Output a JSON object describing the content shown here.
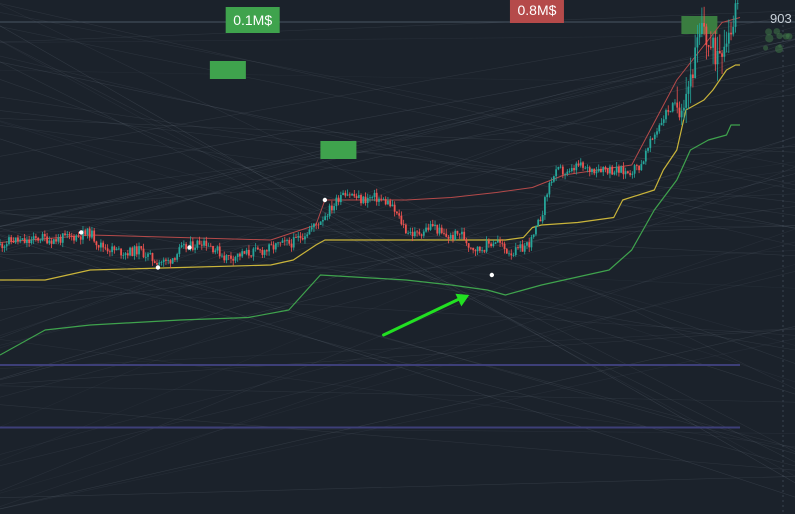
{
  "chart_data": {
    "type": "candlestick",
    "title": "",
    "xlabel": "",
    "ylabel": "",
    "ylim": [
      0,
      100
    ],
    "grid": false,
    "legend": "none",
    "y_axis_labels": [
      {
        "value": 96.2,
        "text": "903"
      }
    ],
    "volume_labels": [
      {
        "text": "0.1M$",
        "x": 56,
        "y": 96,
        "color": "#3fa34d"
      },
      {
        "text": "0.8M$",
        "x": 119,
        "y": 98,
        "color": "#b54a4a"
      }
    ],
    "volume_boxes": [
      {
        "x": 50.5,
        "y": 86,
        "color": "#3fa34d"
      },
      {
        "x": 75,
        "y": 70,
        "color": "#3fa34d"
      },
      {
        "x": 155,
        "y": 95,
        "color": "#3a7d40"
      }
    ],
    "price": [
      [
        0,
        51
      ],
      [
        3,
        52
      ],
      [
        6,
        51.5
      ],
      [
        9,
        52.5
      ],
      [
        12,
        52
      ],
      [
        15,
        52.5
      ],
      [
        18,
        53
      ],
      [
        20,
        53.5
      ],
      [
        22,
        51
      ],
      [
        25,
        50
      ],
      [
        28,
        49.5
      ],
      [
        31,
        50
      ],
      [
        34,
        48
      ],
      [
        37,
        47.5
      ],
      [
        40,
        50
      ],
      [
        43,
        51
      ],
      [
        45,
        52
      ],
      [
        48,
        50
      ],
      [
        50,
        48.5
      ],
      [
        53,
        49
      ],
      [
        56,
        49.5
      ],
      [
        59,
        50
      ],
      [
        62,
        51
      ],
      [
        65,
        51.5
      ],
      [
        67,
        53
      ],
      [
        70,
        55
      ],
      [
        72,
        57
      ],
      [
        74,
        59
      ],
      [
        76,
        62
      ],
      [
        78,
        61
      ],
      [
        80,
        60
      ],
      [
        83,
        60.5
      ],
      [
        86,
        59.5
      ],
      [
        88,
        57
      ],
      [
        90,
        54
      ],
      [
        92,
        53
      ],
      [
        94,
        54
      ],
      [
        96,
        55
      ],
      [
        98,
        53
      ],
      [
        100,
        52.5
      ],
      [
        102,
        53.5
      ],
      [
        104,
        51
      ],
      [
        106,
        50
      ],
      [
        108,
        51
      ],
      [
        110,
        52
      ],
      [
        112,
        50
      ],
      [
        114,
        49.5
      ],
      [
        116,
        50.5
      ],
      [
        118,
        52
      ],
      [
        120,
        57
      ],
      [
        122,
        64
      ],
      [
        124,
        66
      ],
      [
        126,
        65
      ],
      [
        128,
        67
      ],
      [
        130,
        66
      ],
      [
        133,
        66.5
      ],
      [
        136,
        66
      ],
      [
        139,
        65.5
      ],
      [
        142,
        67
      ],
      [
        144,
        71
      ],
      [
        146,
        75
      ],
      [
        148,
        78
      ],
      [
        150,
        79
      ],
      [
        152,
        82
      ],
      [
        154,
        88
      ],
      [
        156,
        95
      ],
      [
        157,
        91
      ],
      [
        158,
        89
      ],
      [
        160,
        92
      ],
      [
        162,
        95
      ],
      [
        163,
        99.5
      ],
      [
        164,
        96
      ]
    ],
    "pivots": [
      [
        18,
        53.5
      ],
      [
        35,
        46.5
      ],
      [
        42,
        50.5
      ],
      [
        72,
        60
      ],
      [
        109,
        45
      ]
    ],
    "upper_band": [
      [
        0,
        51.5
      ],
      [
        20,
        53
      ],
      [
        40,
        52.5
      ],
      [
        60,
        52
      ],
      [
        70,
        55
      ],
      [
        72,
        60
      ],
      [
        90,
        60
      ],
      [
        100,
        60.5
      ],
      [
        110,
        61.5
      ],
      [
        118,
        62.5
      ],
      [
        125,
        65
      ],
      [
        140,
        67
      ],
      [
        150,
        84
      ],
      [
        160,
        95.5
      ],
      [
        164,
        96.5
      ]
    ],
    "yellow_band": [
      [
        0,
        44
      ],
      [
        10,
        44
      ],
      [
        20,
        46
      ],
      [
        40,
        46.5
      ],
      [
        60,
        47
      ],
      [
        65,
        48
      ],
      [
        70,
        51
      ],
      [
        72,
        52
      ],
      [
        100,
        52
      ],
      [
        112,
        52
      ],
      [
        116,
        52.5
      ],
      [
        118,
        54.5
      ],
      [
        120,
        55
      ],
      [
        128,
        55.5
      ],
      [
        136,
        56.5
      ],
      [
        138,
        60
      ],
      [
        145,
        62
      ],
      [
        147,
        66
      ],
      [
        150,
        70
      ],
      [
        152,
        78
      ],
      [
        156,
        80
      ],
      [
        158,
        82
      ],
      [
        161,
        86
      ],
      [
        163,
        87
      ],
      [
        164,
        87
      ]
    ],
    "green_band": [
      [
        0,
        29
      ],
      [
        10,
        34
      ],
      [
        20,
        35
      ],
      [
        30,
        35.5
      ],
      [
        40,
        36
      ],
      [
        55,
        36.5
      ],
      [
        64,
        38
      ],
      [
        68,
        42
      ],
      [
        71,
        45
      ],
      [
        90,
        44
      ],
      [
        100,
        43
      ],
      [
        108,
        42
      ],
      [
        112,
        41
      ],
      [
        116,
        42
      ],
      [
        120,
        43
      ],
      [
        125,
        44
      ],
      [
        135,
        46
      ],
      [
        140,
        50
      ],
      [
        145,
        58
      ],
      [
        150,
        64
      ],
      [
        153,
        70
      ],
      [
        157,
        72
      ],
      [
        161,
        73
      ],
      [
        162,
        75
      ],
      [
        164,
        75
      ]
    ],
    "annotation_arrow": {
      "from": [
        85,
        33
      ],
      "to": [
        104,
        41
      ],
      "color": "#22e022"
    },
    "horizontal_lines": [
      {
        "y": 27,
        "color": "#3d3f78"
      },
      {
        "y": 14.5,
        "color": "#3d3f78"
      }
    ],
    "colors": {
      "background": "#1b222b",
      "up": "#26a69a",
      "down": "#ef5350",
      "upper_band": "#b54a4a",
      "yellow_band": "#c9b43a",
      "green_band": "#3fa34d",
      "pivot": "#ffffff",
      "faint_lines": "#8a96a3"
    }
  }
}
